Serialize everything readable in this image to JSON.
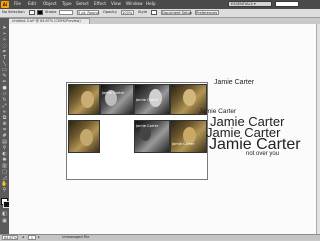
{
  "app": {
    "icon_label": "Ai"
  },
  "menu": [
    "File",
    "Edit",
    "Object",
    "Type",
    "Select",
    "Effect",
    "View",
    "Window",
    "Help"
  ],
  "workspace": {
    "label": "ESSENTIALS ▾"
  },
  "control_bar": {
    "selection": "No Selection",
    "stroke_label": "Stroke",
    "stroke_value": "",
    "brush_value": "5 pt. Round",
    "style_label": "Style",
    "opacity_label": "Opacity",
    "opacity_value": "100%",
    "doc_setup": "Document Setup",
    "preferences": "Preferences"
  },
  "document": {
    "tab_title": "Untitled-3.ai* @ 64.67% (CMYK/Preview)"
  },
  "artwork": {
    "photo_labels": [
      "Jamie Carter",
      "Jamie Carter",
      "Jamie Carter",
      "Jamie Carter",
      "Jamie Carter",
      "Jamie Carter",
      "Jamie Carter"
    ],
    "title_small": "Jamie Carter",
    "title_medium_1": "Jamie Carter",
    "title_medium_2": "Jamie Carter",
    "title_large": "Jamie Carter",
    "tagline": "not over you",
    "overlap_fragment": "Jamie Carter"
  },
  "status": {
    "zoom": "64.67%",
    "page": "1",
    "tool_name": "Unmanaged File"
  }
}
